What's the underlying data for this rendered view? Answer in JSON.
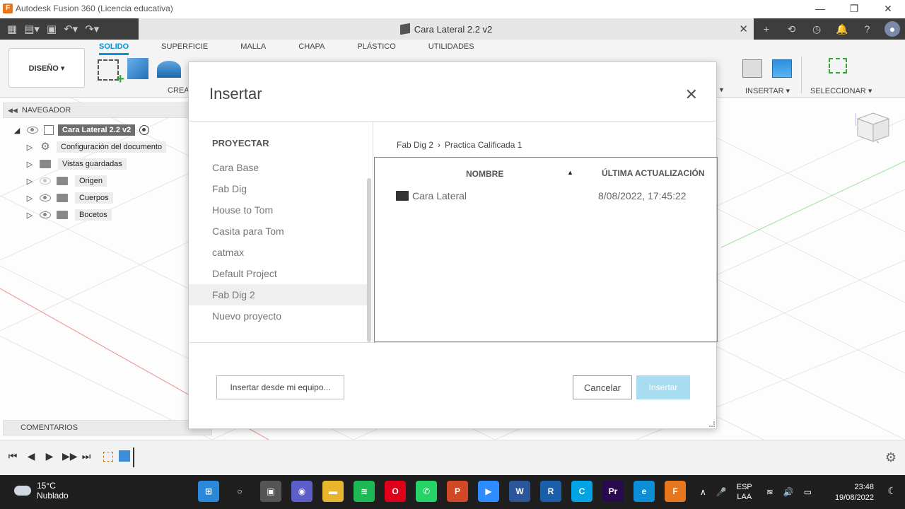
{
  "window": {
    "title": "Autodesk Fusion 360 (Licencia educativa)",
    "controls": {
      "minimize": "—",
      "maximize": "❐",
      "close": "✕"
    }
  },
  "document": {
    "tab_name": "Cara Lateral 2.2 v2",
    "close": "✕"
  },
  "apptoolbar": {
    "grid_icon": "grid-icon",
    "file_icon": "file-icon",
    "save_icon": "save-icon",
    "undo_icon": "undo-icon",
    "redo_icon": "redo-icon",
    "right_icons": [
      "+",
      "⟲",
      "◷",
      "🔔",
      "?",
      "●"
    ]
  },
  "ribbon": {
    "workspace": "DISEÑO ▾",
    "tabs": [
      "SOLIDO",
      "SUPERFICIE",
      "MALLA",
      "CHAPA",
      "PLÁSTICO",
      "UTILIDADES"
    ],
    "active_tab": "SOLIDO",
    "create_label": "CREA",
    "insert_label": "INSERTAR ▾",
    "select_label": "SELECCIONAR ▾"
  },
  "navigator": {
    "label": "NAVEGADOR",
    "root": "Cara Lateral 2.2 v2",
    "items": [
      {
        "label": "Configuración del documento",
        "icon": "gear-icon"
      },
      {
        "label": "Vistas guardadas",
        "icon": "folder-icon"
      },
      {
        "label": "Origen",
        "icon": "folder-icon"
      },
      {
        "label": "Cuerpos",
        "icon": "folder-icon"
      },
      {
        "label": "Bocetos",
        "icon": "folder-icon"
      }
    ]
  },
  "comments": {
    "label": "COMENTARIOS"
  },
  "dialog": {
    "title": "Insertar",
    "close": "✕",
    "projects_heading": "PROYECTAR",
    "projects": [
      "Cara Base",
      "Fab Dig",
      "House to Tom",
      "Casita para Tom",
      "catmax",
      "Default Project",
      "Fab Dig 2",
      "Nuevo proyecto"
    ],
    "selected_project": "Fab Dig 2",
    "breadcrumb": [
      "Fab Dig 2",
      "Practica Calificada 1"
    ],
    "breadcrumb_sep": "›",
    "columns": {
      "name": "NOMBRE",
      "updated": "ÚLTIMA ACTUALIZACIÓN",
      "sort_arrow": "▲"
    },
    "files": [
      {
        "name": "Cara Lateral",
        "updated": "8/08/2022, 17:45:22"
      }
    ],
    "buttons": {
      "local": "Insertar desde mi equipo...",
      "cancel": "Cancelar",
      "insert": "Insertar"
    }
  },
  "timeline": {
    "buttons": [
      "⏮",
      "◀",
      "▶",
      "▶▶",
      "⏭"
    ],
    "settings_icon": "⚙"
  },
  "taskbar": {
    "temperature": "15°C",
    "condition": "Nublado",
    "apps": [
      {
        "name": "windows-start",
        "color": "#2b88d8",
        "glyph": "⊞"
      },
      {
        "name": "search",
        "color": "#1f1f1f",
        "glyph": "○"
      },
      {
        "name": "task-view",
        "color": "#555555",
        "glyph": "▣"
      },
      {
        "name": "chat",
        "color": "#5b5fc7",
        "glyph": "◉"
      },
      {
        "name": "file-explorer",
        "color": "#e8b62c",
        "glyph": "▬"
      },
      {
        "name": "spotify",
        "color": "#1db954",
        "glyph": "≋"
      },
      {
        "name": "opera",
        "color": "#e0001a",
        "glyph": "O"
      },
      {
        "name": "whatsapp",
        "color": "#25d366",
        "glyph": "✆"
      },
      {
        "name": "powerpoint",
        "color": "#d24726",
        "glyph": "P"
      },
      {
        "name": "zoom",
        "color": "#2d8cff",
        "glyph": "▶"
      },
      {
        "name": "word",
        "color": "#2b579a",
        "glyph": "W"
      },
      {
        "name": "revit",
        "color": "#1b5fa8",
        "glyph": "R"
      },
      {
        "name": "cortona",
        "color": "#00a4e4",
        "glyph": "C"
      },
      {
        "name": "premiere",
        "color": "#2a0a4e",
        "glyph": "Pr"
      },
      {
        "name": "edge",
        "color": "#0c8fd6",
        "glyph": "e"
      },
      {
        "name": "fusion360",
        "color": "#e8761c",
        "glyph": "F"
      }
    ],
    "tray": {
      "chevron": "∧",
      "mic": "🎤",
      "lang1": "ESP",
      "lang2": "LAA",
      "wifi": "≋",
      "volume": "🔊",
      "battery": "▭"
    },
    "time": "23:48",
    "date": "19/08/2022",
    "notification_icon": "☾"
  }
}
